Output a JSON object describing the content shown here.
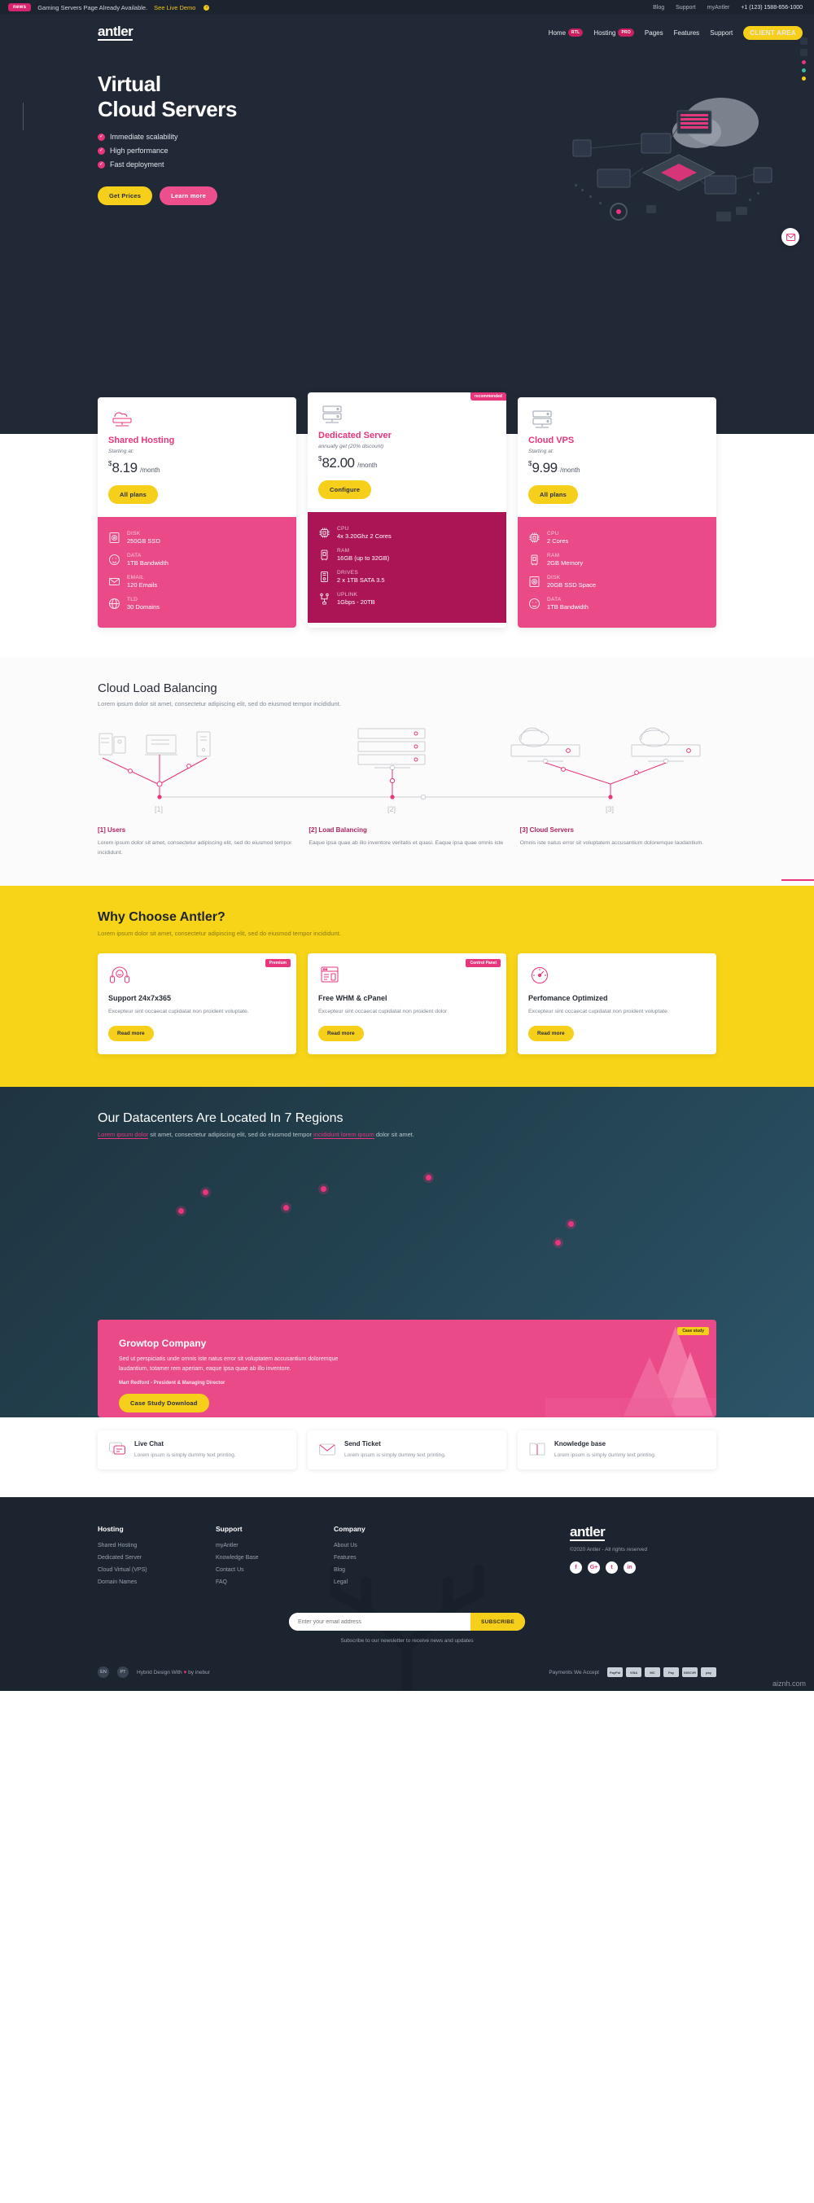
{
  "topbar": {
    "badge": "news",
    "message": "Gaming Servers Page Already Available.",
    "link": "See Live Demo",
    "utils": [
      "Blog",
      "Support",
      "myAntler"
    ],
    "phone": "+1 (123) 1588-656-1000"
  },
  "header": {
    "logo": "antler",
    "nav": [
      {
        "label": "Home",
        "pill": "RTL"
      },
      {
        "label": "Hosting",
        "pill": "PRO"
      },
      {
        "label": "Pages",
        "pill": ""
      },
      {
        "label": "Features",
        "pill": ""
      },
      {
        "label": "Support",
        "pill": ""
      }
    ],
    "cta": "CLIENT AREA"
  },
  "hero": {
    "title_line1": "Virtual",
    "title_line2": "Cloud Servers",
    "bullets": [
      "Immediate scalability",
      "High performance",
      "Fast deployment"
    ],
    "btn_primary": "Get Prices",
    "btn_secondary": "Learn more"
  },
  "pricing": {
    "cards": [
      {
        "icon": "cloud-server-icon",
        "title": "Shared Hosting",
        "subtitle": "Starting at:",
        "currency": "$",
        "amount": "8.19",
        "per": "/month",
        "cta": "All plans",
        "ribbon": "",
        "theme": "light",
        "specs": [
          {
            "icon": "disk-icon",
            "key": "DISK",
            "value": "250GB SSD"
          },
          {
            "icon": "data-icon",
            "key": "DATA",
            "value": "1TB Bandwidth"
          },
          {
            "icon": "email-icon",
            "key": "EMAIL",
            "value": "120 Emails"
          },
          {
            "icon": "globe-icon",
            "key": "TLD",
            "value": "30 Domains"
          }
        ]
      },
      {
        "icon": "rack-server-icon",
        "title": "Dedicated Server",
        "subtitle": "annually get (20% discount)",
        "currency": "$",
        "amount": "82.00",
        "per": "/month",
        "cta": "Configure",
        "ribbon": "recommended",
        "theme": "dark",
        "specs": [
          {
            "icon": "cpu-icon",
            "key": "CPU",
            "value": "4x 3.20Ghz 2 Cores"
          },
          {
            "icon": "ram-icon",
            "key": "RAM",
            "value": "16GB (up to 32GB)"
          },
          {
            "icon": "drives-icon",
            "key": "DRIVES",
            "value": "2 x 1TB SATA 3.5"
          },
          {
            "icon": "uplink-icon",
            "key": "UPLINK",
            "value": "1Gbps - 20TB"
          }
        ]
      },
      {
        "icon": "rack-server-icon",
        "title": "Cloud VPS",
        "subtitle": "Starting at:",
        "currency": "$",
        "amount": "9.99",
        "per": "/month",
        "cta": "All plans",
        "ribbon": "",
        "theme": "light",
        "specs": [
          {
            "icon": "cpu-icon",
            "key": "CPU",
            "value": "2 Cores"
          },
          {
            "icon": "ram-icon",
            "key": "RAM",
            "value": "2GB Memory"
          },
          {
            "icon": "disk-icon",
            "key": "DISK",
            "value": "20GB SSD Space"
          },
          {
            "icon": "data-icon",
            "key": "DATA",
            "value": "1TB Bandwidth"
          }
        ]
      }
    ]
  },
  "loadbalancing": {
    "title": "Cloud Load Balancing",
    "subtitle": "Lorem ipsum dolor sit amet, consectetur adipiscing elit, sed do eiusmod tempor incididunt.",
    "node_labels": [
      "[1]",
      "[2]",
      "[3]"
    ],
    "columns": [
      {
        "title": "[1] Users",
        "text": "Lorem ipsum dolor sit amet, consectetur adipiscing elit, sed do eiusmod tempor incididunt."
      },
      {
        "title": "[2] Load Balancing",
        "text": "Eaque ipsa quae ab illo inventore veritatis et quasi. Eaque ipsa quae omnis iste"
      },
      {
        "title": "[3] Cloud Servers",
        "text": "Omnis iste natus error sit voluptatem accusantium doloremque laudantium."
      }
    ]
  },
  "why": {
    "title": "Why Choose Antler?",
    "subtitle": "Lorem ipsum dolor sit amet, consectetur adipiscing elit, sed do eiusmod tempor incididunt.",
    "cards": [
      {
        "icon": "support-headset-icon",
        "tag": "Premium",
        "title": "Support 24x7x365",
        "text": "Excepteur sint occaecat cupidatat non proident voluptate.",
        "cta": "Read more"
      },
      {
        "icon": "control-panel-icon",
        "tag": "Control Panel",
        "title": "Free WHM & cPanel",
        "text": "Excepteur sint occaecat cupidatat non proident dolor",
        "cta": "Read more"
      },
      {
        "icon": "performance-icon",
        "tag": "",
        "title": "Perfomance Optimized",
        "text": "Excepteur sint occaecat cupidatat non proident voluptate.",
        "cta": "Read more"
      }
    ]
  },
  "datacenters": {
    "title": "Our Datacenters Are Located In 7 Regions",
    "subtitle_pre": "",
    "subtitle_hl1": "Lorem ipsum dolor",
    "subtitle_mid": " sit amet, consectetur adipiscing elit, sed do eiusmod tempor ",
    "subtitle_hl2": "incididunt lorem ipsum",
    "subtitle_post": " dolor sit amet.",
    "markers": [
      {
        "x": 17,
        "y": 22
      },
      {
        "x": 13,
        "y": 33
      },
      {
        "x": 36,
        "y": 20
      },
      {
        "x": 30,
        "y": 31
      },
      {
        "x": 53,
        "y": 13
      },
      {
        "x": 76,
        "y": 41
      },
      {
        "x": 74,
        "y": 52
      }
    ]
  },
  "casestudy": {
    "tag": "Case study",
    "title": "Growtop Company",
    "text": "Sed ut perspiciatis unde omnis iste natus error sit voluptatem accusantium doloremque laudantium, totamer rem aperiam, eaque ipsa quae ab illo inventore.",
    "author": "Mart Redford - President & Managing Director",
    "cta": "Case Study Download"
  },
  "tiles": [
    {
      "icon": "live-chat-icon",
      "title": "Live Chat",
      "text": "Lorem ipsum is simply dummy text printing."
    },
    {
      "icon": "send-ticket-icon",
      "title": "Send Ticket",
      "text": "Lorem ipsum is simply dummy text printing."
    },
    {
      "icon": "knowledge-base-icon",
      "title": "Knowledge base",
      "text": "Lorem ipsum is simply dummy text printing."
    }
  ],
  "footer": {
    "columns": [
      {
        "title": "Hosting",
        "links": [
          "Shared Hosting",
          "Dedicated Server",
          "Cloud Virtual (VPS)",
          "Domain Names"
        ]
      },
      {
        "title": "Support",
        "links": [
          "myAntler",
          "Knowledge Base",
          "Contact Us",
          "FAQ"
        ]
      },
      {
        "title": "Company",
        "links": [
          "About Us",
          "Features",
          "Blog",
          "Legal"
        ]
      }
    ],
    "logo": "antler",
    "copyright": "©2020 Antler - All rights reserved",
    "socials": [
      {
        "name": "facebook-icon",
        "glyph": "f"
      },
      {
        "name": "google-plus-icon",
        "glyph": "G+"
      },
      {
        "name": "twitter-icon",
        "glyph": "t"
      },
      {
        "name": "linkedin-icon",
        "glyph": "in"
      }
    ],
    "newsletter": {
      "placeholder": "Enter your email address",
      "button": "SUBSCRIBE",
      "note": "Subscribe to our newsletter to receive news and updates"
    },
    "languages": [
      "EN",
      "PT"
    ],
    "credit_pre": "Hybrid Design With ",
    "credit_heart": "♥",
    "credit_post": " by inebur",
    "payments_label": "Payments We Accept",
    "payments": [
      "PayPal",
      "VISA",
      "MC",
      "Pay",
      "DISCVR",
      "pay"
    ]
  },
  "watermark": "aiznh.com",
  "colors": {
    "pink": "#e8357c",
    "deep_pink": "#ac1555",
    "yellow": "#f5cf19",
    "dark": "#212936",
    "footer_dark": "#1c2430"
  }
}
